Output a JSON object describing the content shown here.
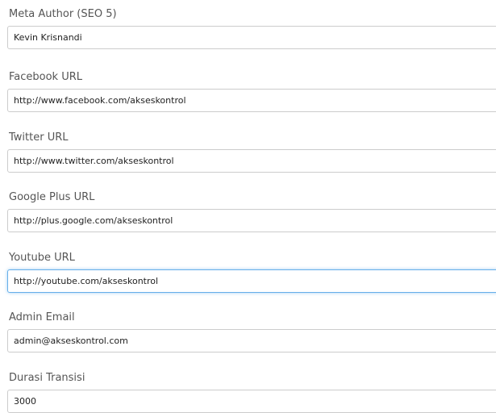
{
  "form": {
    "fields": [
      {
        "label": "Meta Author (SEO 5)",
        "value": "Kevin Krisnandi"
      },
      {
        "label": "Facebook URL",
        "value": "http://www.facebook.com/akseskontrol"
      },
      {
        "label": "Twitter URL",
        "value": "http://www.twitter.com/akseskontrol"
      },
      {
        "label": "Google Plus URL",
        "value": "http://plus.google.com/akseskontrol"
      },
      {
        "label": "Youtube URL",
        "value": "http://youtube.com/akseskontrol"
      },
      {
        "label": "Admin Email",
        "value": "admin@akseskontrol.com"
      },
      {
        "label": "Durasi Transisi",
        "value": "3000"
      }
    ],
    "focused_field": "Youtube URL"
  },
  "colors": {
    "label_text": "#555555",
    "input_border": "#cccccc",
    "focus_border": "#66afe9"
  }
}
